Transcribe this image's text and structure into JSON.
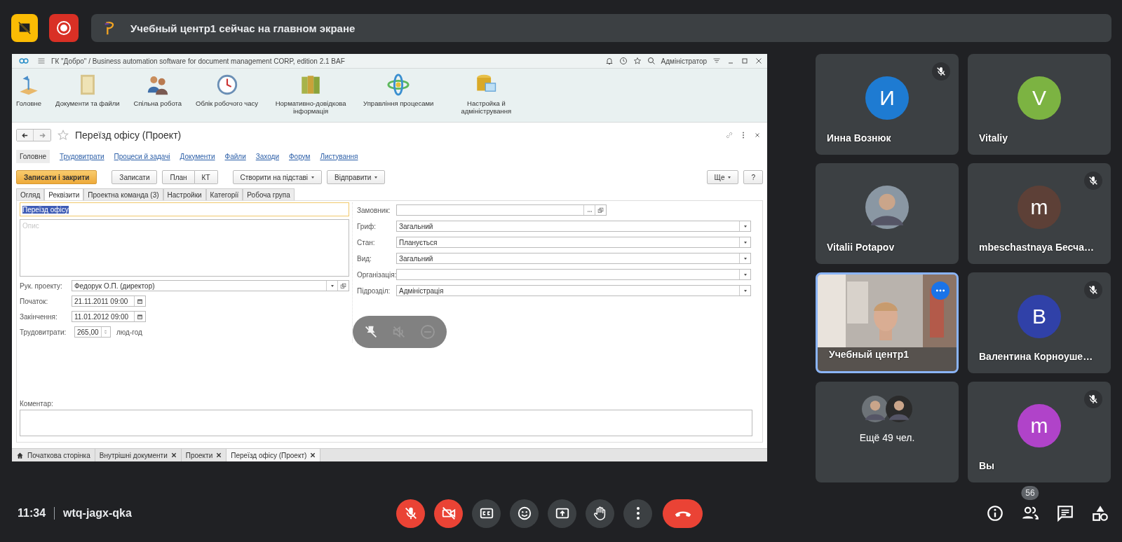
{
  "top_bar": {
    "presenter_banner": "Учебный центр1 сейчас на главном экране"
  },
  "shared_screen": {
    "title": "ГК \"Добро\" / Business automation software for document management CORP, edition 2.1 BAF",
    "user": "Адміністратор",
    "sections": [
      "Головне",
      "Документи та файли",
      "Спільна робота",
      "Облік робочого часу",
      "Нормативно-довідкова інформація",
      "Управління процесами",
      "Настройка й адміністрування"
    ],
    "form_title": "Переїзд офісу (Проект)",
    "nav_links": [
      {
        "label": "Головне",
        "selected": true
      },
      {
        "label": "Трудовитрати",
        "selected": false
      },
      {
        "label": "Процеси й задачі",
        "selected": false
      },
      {
        "label": "Документи",
        "selected": false
      },
      {
        "label": "Файли",
        "selected": false
      },
      {
        "label": "Заходи",
        "selected": false
      },
      {
        "label": "Форум",
        "selected": false
      },
      {
        "label": "Листування",
        "selected": false
      }
    ],
    "toolbar": [
      {
        "label": "Записати і закрити",
        "kind": "default"
      },
      {
        "label": "Записати",
        "kind": "plain"
      },
      {
        "label": "План",
        "kind": "group_start"
      },
      {
        "label": "КТ",
        "kind": "group_end"
      },
      {
        "label": "Створити на підставі",
        "kind": "menu"
      },
      {
        "label": "Відправити",
        "kind": "menu"
      }
    ],
    "toolbar_right": [
      {
        "label": "Ще",
        "kind": "menu"
      },
      {
        "label": "?",
        "kind": "plain"
      }
    ],
    "tabs": [
      {
        "label": "Огляд",
        "selected": false
      },
      {
        "label": "Реквізити",
        "selected": true
      },
      {
        "label": "Проектна команда (3)",
        "selected": false
      },
      {
        "label": "Настройки",
        "selected": false
      },
      {
        "label": "Категорії",
        "selected": false
      },
      {
        "label": "Робоча група",
        "selected": false
      }
    ],
    "name_field": "Переїзд офісу",
    "description_placeholder": "Опис",
    "left_fields": [
      {
        "label": "Рук. проекту:",
        "value": "Федорук О.П. (директор)",
        "kind": "select"
      },
      {
        "label": "Початок:",
        "value": "21.11.2011 09:00",
        "kind": "date"
      },
      {
        "label": "Закінчення:",
        "value": "11.01.2012 09:00",
        "kind": "date"
      },
      {
        "label": "Трудовитрати:",
        "value": "265,00",
        "kind": "number",
        "unit": "люд-год"
      }
    ],
    "right_fields": [
      {
        "label": "Замовник:",
        "kind": "lookup"
      },
      {
        "label": "Гриф:",
        "value": "Загальний",
        "kind": "select"
      },
      {
        "label": "Стан:",
        "value": "Планується",
        "kind": "select"
      },
      {
        "label": "Вид:",
        "value": "Загальний",
        "kind": "select"
      },
      {
        "label": "Організація:",
        "kind": "select"
      },
      {
        "label": "Підрозділ:",
        "value": "Адміністрація",
        "kind": "select"
      }
    ],
    "comment_label": "Коментар:",
    "open_windows": [
      {
        "label": "Початкова сторінка",
        "kind": "home",
        "selected": false
      },
      {
        "label": "Внутрішні документи",
        "kind": "closable",
        "selected": false
      },
      {
        "label": "Проекти",
        "kind": "closable",
        "selected": false
      },
      {
        "label": "Переїзд офісу (Проект)",
        "kind": "closable",
        "selected": true
      }
    ]
  },
  "participants": [
    {
      "name": "Инна Вознюк",
      "kind": "initial",
      "initial": "И",
      "color": "#1e7bd2",
      "muted": true,
      "active_speaker": false
    },
    {
      "name": "Vitaliy",
      "kind": "initial",
      "initial": "V",
      "color": "#7cb342",
      "muted": false,
      "active_speaker": false
    },
    {
      "name": "Vitalii Potapov",
      "muted": false,
      "active_speaker": false
    },
    {
      "name": "mbeschastnaya Бесча…",
      "kind": "initial",
      "initial": "m",
      "color": "#5d4037",
      "muted": true,
      "active_speaker": false
    },
    {
      "name": "Учебный центр1",
      "kind": "video",
      "muted": false,
      "active_speaker": true
    },
    {
      "name": "Валентина Корноуше…",
      "kind": "initial",
      "initial": "В",
      "color": "#3041a8",
      "muted": true,
      "active_speaker": false
    },
    {
      "name": "Ещё 49 чел.",
      "kind": "others",
      "muted": false,
      "active_speaker": false
    },
    {
      "name": "Вы",
      "kind": "initial",
      "initial": "m",
      "color": "#b043c9",
      "muted": true,
      "active_speaker": false
    }
  ],
  "call": {
    "time": "11:34",
    "meeting_code": "wtq-jagx-qka",
    "mic_on": false,
    "camera_on": false,
    "people_count": "56"
  }
}
